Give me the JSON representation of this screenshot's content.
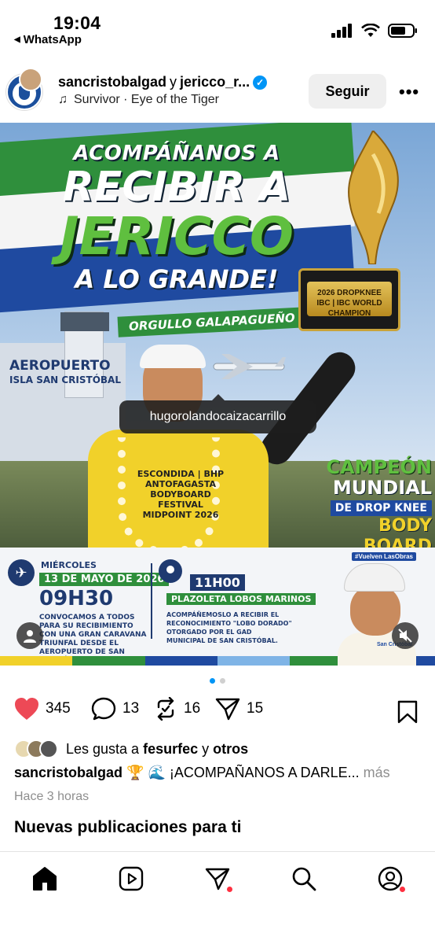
{
  "status_bar": {
    "time": "19:04",
    "back_app": "WhatsApp"
  },
  "post": {
    "username": "sancristobalgad",
    "connector": "y",
    "collaborator": "jericco_r...",
    "audio": "Survivor · Eye of the Tiger",
    "follow_label": "Seguir"
  },
  "media": {
    "headline_line1": "ACOMPÁÑANOS A",
    "headline_line2": "RECIBIR A",
    "headline_line3": "JERICCO",
    "headline_line4": "A LO GRANDE!",
    "tagline": "ORGULLO GALAPAGUEÑO ♡",
    "trophy_plate": "2026 DROPKNEE\nIBC | IBC WORLD CHAMPION",
    "airport_line1": "AEROPUERTO",
    "airport_line2": "ISLA SAN CRISTÓBAL",
    "vest_text": "ESCONDIDA | BHP\nANTOFAGASTA\nBODYBOARD\nFESTIVAL\nMIDPOINT 2026",
    "champion_line1": "CAMPEÓN",
    "champion_line2": "MUNDIAL",
    "champion_line3": "DE DROP KNEE",
    "champion_line4": "BODY BOARD",
    "tagged_user": "hugorolandocaizacarrillo",
    "event_day": "MIÉRCOLES",
    "event_date": "13 DE MAYO DE 2026",
    "event_time1": "09H30",
    "event_text1": "CONVOCAMOS A TODOS PARA SU RECIBIMIENTO CON UNA GRAN CARAVANA TRIUNFAL DESDE EL AEROPUERTO DE SAN CRISTÓBAL.",
    "event_time2": "11H00",
    "event_place": "PLAZOLETA LOBOS MARINOS",
    "event_text2": "ACOMPÁÑEMOSLO A RECIBIR EL RECONOCIMIENTO \"LOBO DORADO\" OTORGADO POR EL GAD MUNICIPAL DE SAN CRISTÓBAL.",
    "mascot_tag": "#Vuelven LasObras",
    "mascot_shirt": "San Cristóbal"
  },
  "carousel": {
    "total": 2,
    "active": 1
  },
  "actions": {
    "likes": "345",
    "comments": "13",
    "reposts": "16",
    "shares": "15"
  },
  "likes_line": {
    "prefix": "Les gusta a",
    "user": "fesurfec",
    "connector": "y",
    "others": "otros"
  },
  "caption": {
    "user": "sancristobalgad",
    "text": "🏆 🌊 ¡ACOMPAÑANOS A DARLE...",
    "more": "más"
  },
  "time_ago": "Hace 3 horas",
  "section_title": "Nuevas publicaciones para ti",
  "colors": {
    "like_red": "#ed4956",
    "verified_blue": "#0095f6",
    "notification_red": "#ff3040",
    "brand_green": "#2f8f3c",
    "brand_blue": "#1f4aa0"
  },
  "icons": {
    "nav": [
      "home-icon",
      "reels-icon",
      "direct-message-icon",
      "search-icon",
      "profile-icon"
    ]
  }
}
